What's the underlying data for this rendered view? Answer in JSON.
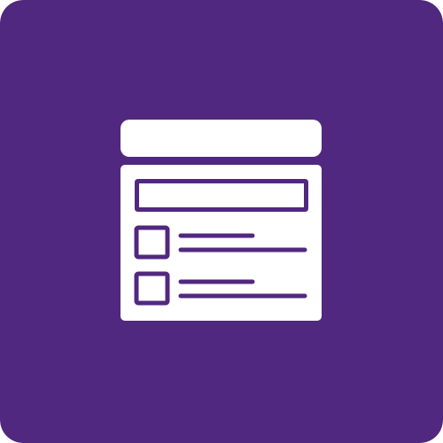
{
  "icon": {
    "name": "form-window-icon",
    "colors": {
      "background": "#51287f",
      "foreground": "#ffffff"
    }
  }
}
